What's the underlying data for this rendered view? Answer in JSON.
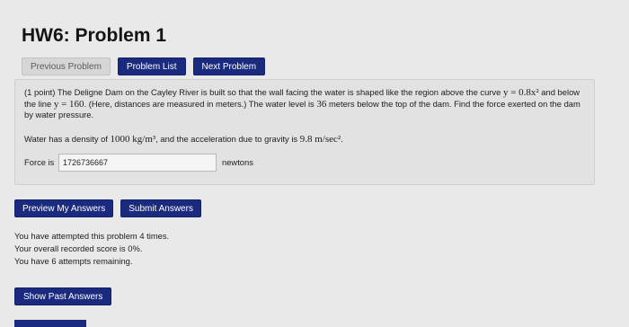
{
  "page": {
    "title": "HW6: Problem 1"
  },
  "nav": {
    "previous": "Previous Problem",
    "list": "Problem List",
    "next": "Next Problem"
  },
  "problem": {
    "text_1": "(1 point) The Deligne Dam on the Cayley River is built so that the wall facing the water is shaped like the region above the curve ",
    "curve": "y = 0.8x²",
    "text_2": " and below the line ",
    "line": "y = 160",
    "text_3": ". (Here, distances are measured in meters.) The water level is ",
    "depth": "36",
    "text_4": " meters below the top of the dam. Find the force exerted on the dam by water pressure.",
    "density_1": "Water has a density of ",
    "density": "1000 kg/m³",
    "density_2": ", and the acceleration due to gravity is ",
    "gravity": "9.8 m/sec²",
    "density_3": "."
  },
  "answer": {
    "label": "Force is",
    "value": "1726736667",
    "unit": "newtons"
  },
  "actions": {
    "preview": "Preview My Answers",
    "submit": "Submit Answers"
  },
  "status": {
    "attempts": "You have attempted this problem 4 times.",
    "score": "Your overall recorded score is 0%.",
    "remaining": "You have 6 attempts remaining."
  },
  "past": {
    "label": "Show Past Answers"
  },
  "colors": {
    "primary_button": "#1a2a7e",
    "background": "#e9e9e9"
  }
}
